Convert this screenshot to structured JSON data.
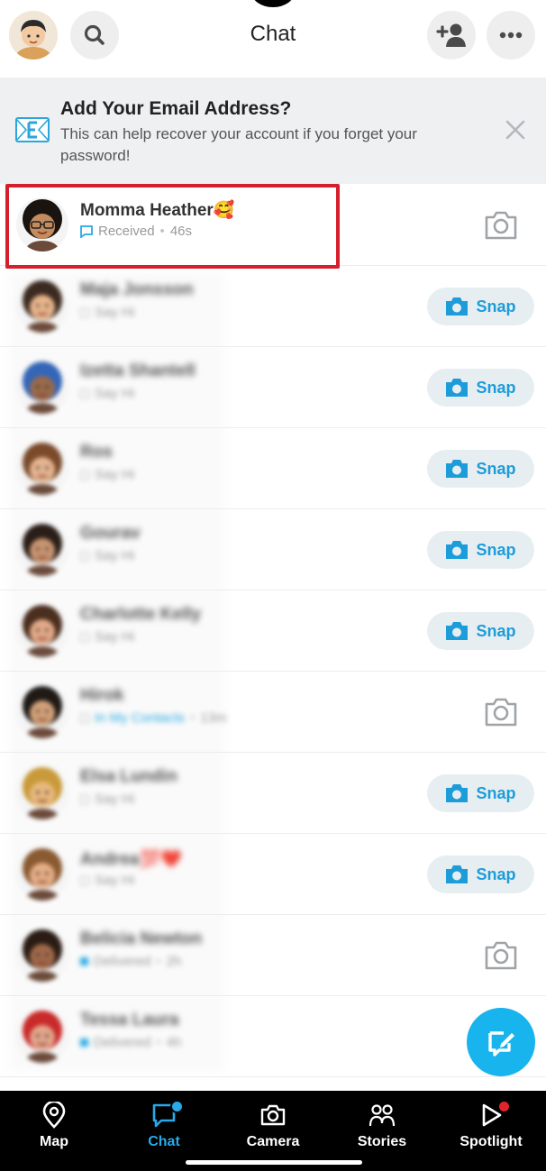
{
  "header": {
    "title": "Chat",
    "icons": {
      "profile": "bitmoji-avatar",
      "search": "search-icon",
      "add_friend": "add-friend-icon",
      "more": "more-icon"
    }
  },
  "banner": {
    "title": "Add Your Email Address?",
    "text": "This can help recover your account if you forget your password!",
    "icon": "email-icon",
    "close_icon": "close-icon"
  },
  "chats": [
    {
      "name": "Momma Heather🥰",
      "status": "Received",
      "time": "46s",
      "action": "camera",
      "status_color": "#27aae1",
      "highlighted": true,
      "skin": "#c48c5e",
      "hair": "#1a1410"
    },
    {
      "name": "Maja Jonsson",
      "status": "Say Hi",
      "time": "",
      "action": "snap",
      "skin": "#e8b48a",
      "hair": "#3b2a20"
    },
    {
      "name": "Izetta Shantell",
      "status": "Say Hi",
      "time": "",
      "action": "snap",
      "skin": "#9a6a4a",
      "hair": "#3466b8"
    },
    {
      "name": "Ros",
      "status": "Say Hi",
      "time": "",
      "action": "snap",
      "skin": "#e6b490",
      "hair": "#7a4a2a"
    },
    {
      "name": "Gourav",
      "status": "Say Hi",
      "time": "",
      "action": "snap",
      "skin": "#c99470",
      "hair": "#2a1e18"
    },
    {
      "name": "Charlotte Kelly",
      "status": "Say Hi",
      "time": "",
      "action": "snap",
      "skin": "#e2a988",
      "hair": "#4a2e1e"
    },
    {
      "name": "Hirok",
      "status": "In My Contacts",
      "time": "13m",
      "action": "camera",
      "skin": "#d2a078",
      "hair": "#1f1a16"
    },
    {
      "name": "Elsa Lundin",
      "status": "Say Hi",
      "time": "",
      "action": "snap",
      "skin": "#e8b87e",
      "hair": "#c99a3a"
    },
    {
      "name": "Andrea💯❤️",
      "status": "Say Hi",
      "time": "",
      "action": "snap",
      "skin": "#e4ad86",
      "hair": "#8a5a32"
    },
    {
      "name": "Belicia Newton",
      "status": "Delivered",
      "time": "2h",
      "action": "camera",
      "skin": "#a0684a",
      "hair": "#2a1c14"
    },
    {
      "name": "Tessa Laura",
      "status": "Delivered",
      "time": "4h",
      "action": "none",
      "skin": "#e2a58a",
      "hair": "#c92a2a"
    }
  ],
  "snap_label": "Snap",
  "nav": [
    {
      "label": "Map",
      "icon": "map-pin-icon"
    },
    {
      "label": "Chat",
      "icon": "chat-icon",
      "active": true,
      "badge_color": "#29a9ea"
    },
    {
      "label": "Camera",
      "icon": "camera-icon"
    },
    {
      "label": "Stories",
      "icon": "stories-icon"
    },
    {
      "label": "Spotlight",
      "icon": "spotlight-icon",
      "badge_color": "#e3242b"
    }
  ],
  "colors": {
    "accent": "#18b4ee",
    "highlight": "#d61f2c",
    "snap_text": "#1c9cd9"
  }
}
